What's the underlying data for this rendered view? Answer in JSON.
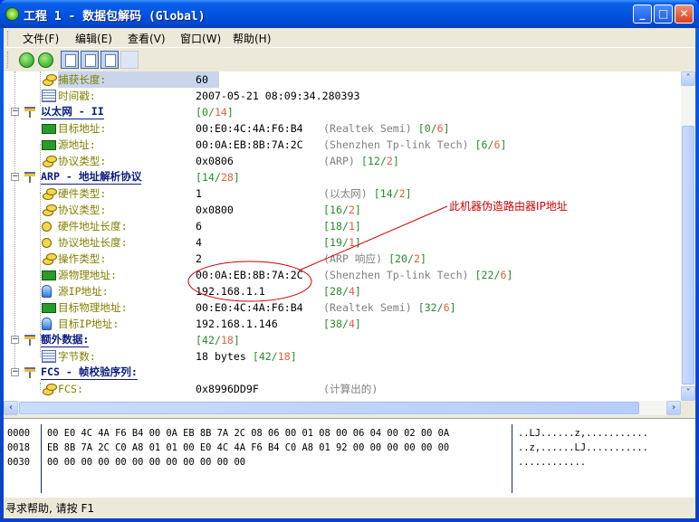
{
  "window": {
    "title": "工程 1 - 数据包解码 (Global)",
    "buttons": {
      "minimize": "_",
      "maximize": "□",
      "close": "✕"
    }
  },
  "menu": [
    {
      "label": "文件(F)"
    },
    {
      "label": "编辑(E)"
    },
    {
      "label": "查看(V)"
    },
    {
      "label": "窗口(W)"
    },
    {
      "label": "帮助(H)"
    }
  ],
  "toolbar": {
    "buttons": [
      "back",
      "forward",
      "view-decode",
      "view-hex",
      "view-list",
      "view-columns"
    ]
  },
  "tree": {
    "rows": [
      {
        "type": "field",
        "depth": 1,
        "icon": "coins",
        "label": "捕获长度:",
        "value": "60",
        "selected": true
      },
      {
        "type": "field",
        "depth": 1,
        "icon": "doc",
        "label": "时间戳:",
        "value": "2007-05-21 08:09:34.280393"
      },
      {
        "type": "section",
        "label": "以太网 - II",
        "range": [
          "0",
          "14"
        ]
      },
      {
        "type": "field",
        "depth": 1,
        "icon": "nic",
        "label": "目标地址:",
        "value": "00:E0:4C:4A:F6:B4",
        "note": "(Realtek Semi)",
        "range": [
          "0",
          "6"
        ]
      },
      {
        "type": "field",
        "depth": 1,
        "icon": "nic",
        "label": "源地址:",
        "value": "00:0A:EB:8B:7A:2C",
        "note": "(Shenzhen Tp-link Tech)",
        "range": [
          "6",
          "6"
        ]
      },
      {
        "type": "field",
        "depth": 1,
        "icon": "coins",
        "label": "协议类型:",
        "value": "0x0806",
        "note": "(ARP)",
        "range": [
          "12",
          "2"
        ]
      },
      {
        "type": "section",
        "label": "ARP - 地址解析协议",
        "range": [
          "14",
          "28"
        ]
      },
      {
        "type": "field",
        "depth": 1,
        "icon": "coins",
        "label": "硬件类型:",
        "value": "1",
        "note": "(以太网)",
        "range": [
          "14",
          "2"
        ]
      },
      {
        "type": "field",
        "depth": 1,
        "icon": "coins",
        "label": "协议类型:",
        "value": "0x0800",
        "range": [
          "16",
          "2"
        ]
      },
      {
        "type": "field",
        "depth": 1,
        "icon": "circle",
        "label": "硬件地址长度:",
        "value": "6",
        "range": [
          "18",
          "1"
        ]
      },
      {
        "type": "field",
        "depth": 1,
        "icon": "circle",
        "label": "协议地址长度:",
        "value": "4",
        "range": [
          "19",
          "1"
        ]
      },
      {
        "type": "field",
        "depth": 1,
        "icon": "coins",
        "label": "操作类型:",
        "value": "2",
        "note": "(ARP 响应)",
        "range": [
          "20",
          "2"
        ]
      },
      {
        "type": "field",
        "depth": 1,
        "icon": "nic",
        "label": "源物理地址:",
        "value": "00:0A:EB:8B:7A:2C",
        "note": "(Shenzhen Tp-link Tech)",
        "range": [
          "22",
          "6"
        ]
      },
      {
        "type": "field",
        "depth": 1,
        "icon": "pc",
        "label": "源IP地址:",
        "value": "192.168.1.1",
        "range": [
          "28",
          "4"
        ]
      },
      {
        "type": "field",
        "depth": 1,
        "icon": "nic",
        "label": "目标物理地址:",
        "value": "00:E0:4C:4A:F6:B4",
        "note": "(Realtek Semi)",
        "range": [
          "32",
          "6"
        ]
      },
      {
        "type": "field",
        "depth": 1,
        "icon": "pc",
        "label": "目标IP地址:",
        "value": "192.168.1.146",
        "range": [
          "38",
          "4"
        ]
      },
      {
        "type": "section",
        "label": "额外数据:",
        "range": [
          "42",
          "18"
        ]
      },
      {
        "type": "field",
        "depth": 1,
        "icon": "doc",
        "label": "字节数:",
        "value": "18 bytes",
        "range": [
          "42",
          "18"
        ],
        "range_inline": true
      },
      {
        "type": "section",
        "label": "FCS - 帧校验序列:"
      },
      {
        "type": "field",
        "depth": 1,
        "icon": "coins",
        "label": "FCS:",
        "value": "0x8996DD9F",
        "note": "(计算出的)"
      }
    ]
  },
  "annotation": {
    "text": "此机器伪造路由器IP地址",
    "color": "#cc0000"
  },
  "hex": {
    "rows": [
      {
        "offset": "0000",
        "bytes": "00 E0 4C 4A F6 B4 00 0A EB 8B 7A 2C 08 06 00 01 08 00 06 04 00 02 00 0A",
        "ascii": "..LJ......z,..........."
      },
      {
        "offset": "0018",
        "bytes": "EB 8B 7A 2C C0 A8 01 01 00 E0 4C 4A F6 B4 C0 A8 01 92 00 00 00 00 00 00",
        "ascii": "..z,......LJ..........."
      },
      {
        "offset": "0030",
        "bytes": "00 00 00 00 00 00 00 00 00 00 00 00",
        "ascii": "............"
      }
    ]
  },
  "status": {
    "text": "寻求帮助, 请按 F1"
  },
  "colors": {
    "range_offset": "#2a8a2a",
    "range_length": "#e0603a",
    "field_label": "#808000",
    "section_label": "#0a1e7e",
    "selection": "#c9d5ea"
  }
}
